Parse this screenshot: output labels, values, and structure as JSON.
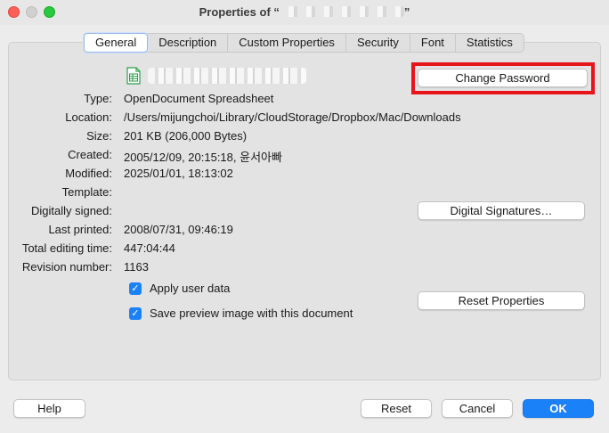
{
  "window": {
    "title_prefix": "Properties of “",
    "title_suffix": "”"
  },
  "tabs": [
    {
      "label": "General",
      "active": true
    },
    {
      "label": "Description"
    },
    {
      "label": "Custom Properties"
    },
    {
      "label": "Security"
    },
    {
      "label": "Font"
    },
    {
      "label": "Statistics"
    }
  ],
  "fields": {
    "type": {
      "label": "Type:",
      "value": "OpenDocument Spreadsheet"
    },
    "location": {
      "label": "Location:",
      "value": "/Users/mijungchoi/Library/CloudStorage/Dropbox/Mac/Downloads"
    },
    "size": {
      "label": "Size:",
      "value": "201 KB (206,000 Bytes)"
    },
    "created": {
      "label": "Created:",
      "value": "2005/12/09, 20:15:18, 윤서아빠"
    },
    "modified": {
      "label": "Modified:",
      "value": "2025/01/01, 18:13:02"
    },
    "template": {
      "label": "Template:",
      "value": ""
    },
    "signed": {
      "label": "Digitally signed:",
      "value": ""
    },
    "printed": {
      "label": "Last printed:",
      "value": "2008/07/31, 09:46:19"
    },
    "editing": {
      "label": "Total editing time:",
      "value": "447:04:44"
    },
    "revision": {
      "label": "Revision number:",
      "value": "1163"
    }
  },
  "buttons": {
    "change_password": "Change Password",
    "digital_signatures": "Digital Signatures…",
    "reset_properties": "Reset Properties",
    "help": "Help",
    "reset": "Reset",
    "cancel": "Cancel",
    "ok": "OK"
  },
  "checkboxes": {
    "apply_user_data": {
      "label": "Apply user data",
      "checked": true
    },
    "save_preview": {
      "label": "Save preview image with this document",
      "checked": true
    }
  },
  "colors": {
    "accent": "#1b81f8",
    "highlight": "#e8141c",
    "spreadsheet_icon": "#2e9e4a"
  },
  "icons": {
    "file": "spreadsheet-file-icon",
    "check": "checkmark-icon"
  }
}
